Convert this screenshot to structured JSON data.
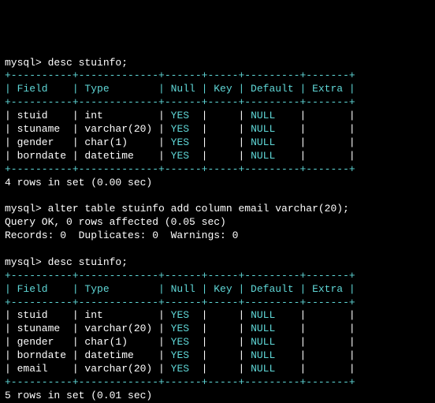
{
  "prompt": "mysql>",
  "cmd1": " desc stuinfo;",
  "cmd2": " alter table stuinfo add column email varchar(20);",
  "cmd3": " desc stuinfo;",
  "border1": "+----------+-------------+------+-----+---------+-------+",
  "header_row": "| Field    | Type        | Null | Key | Default | Extra |",
  "table1": {
    "rows": [
      "| stuid    | int         | ",
      "| stuname  | varchar(20) | ",
      "| gender   | char(1)     | ",
      "| borndate | datetime    | "
    ],
    "yes": "YES",
    "mid": "  |     | ",
    "null": "NULL",
    "end": "    |       |",
    "summary": "4 rows in set (0.00 sec)"
  },
  "alter": {
    "line1": "Query OK, 0 rows affected (0.05 sec)",
    "line2": "Records: 0  Duplicates: 0  Warnings: 0"
  },
  "table2": {
    "rows": [
      "| stuid    | int         | ",
      "| stuname  | varchar(20) | ",
      "| gender   | char(1)     | ",
      "| borndate | datetime    | ",
      "| email    | varchar(20) | "
    ],
    "yes": "YES",
    "mid": "  |     | ",
    "null": "NULL",
    "end": "    |       |",
    "summary": "5 rows in set (0.01 sec)"
  }
}
